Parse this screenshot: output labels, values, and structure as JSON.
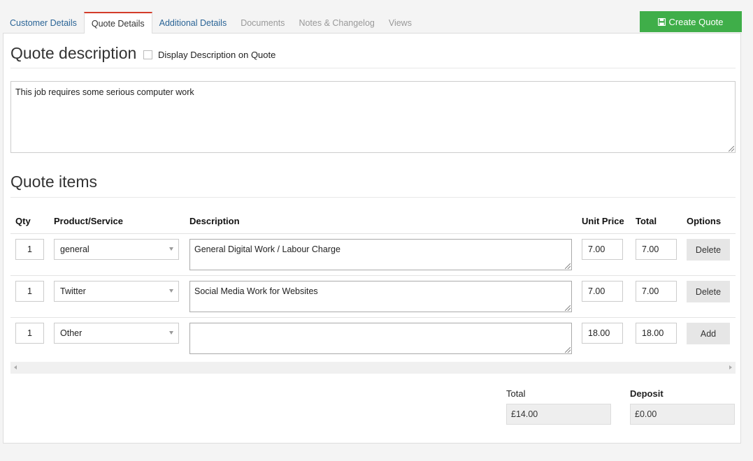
{
  "tabs": [
    {
      "label": "Customer Details",
      "state": "link"
    },
    {
      "label": "Quote Details",
      "state": "active"
    },
    {
      "label": "Additional Details",
      "state": "link"
    },
    {
      "label": "Documents",
      "state": "muted"
    },
    {
      "label": "Notes & Changelog",
      "state": "muted"
    },
    {
      "label": "Views",
      "state": "muted"
    }
  ],
  "create_button": {
    "label": "Create Quote",
    "icon": "save-icon",
    "color": "#3fae49"
  },
  "description_section": {
    "title": "Quote description",
    "checkbox_label": "Display Description on Quote",
    "checkbox_checked": false,
    "text": "This job requires some serious computer work"
  },
  "items_section": {
    "title": "Quote items",
    "columns": [
      "Qty",
      "Product/Service",
      "Description",
      "Unit Price",
      "Total",
      "Options"
    ],
    "rows": [
      {
        "qty": "1",
        "product": "general",
        "description": "General Digital Work / Labour Charge",
        "unit_price": "7.00",
        "total": "7.00",
        "action": "Delete"
      },
      {
        "qty": "1",
        "product": "Twitter",
        "description": "Social Media Work for Websites",
        "unit_price": "7.00",
        "total": "7.00",
        "action": "Delete"
      },
      {
        "qty": "1",
        "product": "Other",
        "description": "",
        "unit_price": "18.00",
        "total": "18.00",
        "action": "Add"
      }
    ]
  },
  "summary": {
    "total_label": "Total",
    "total_value": "£14.00",
    "deposit_label": "Deposit",
    "deposit_value": "£0.00"
  },
  "colors": {
    "active_tab_border": "#d33c2a",
    "link": "#2a6496",
    "button_green": "#3fae49"
  }
}
